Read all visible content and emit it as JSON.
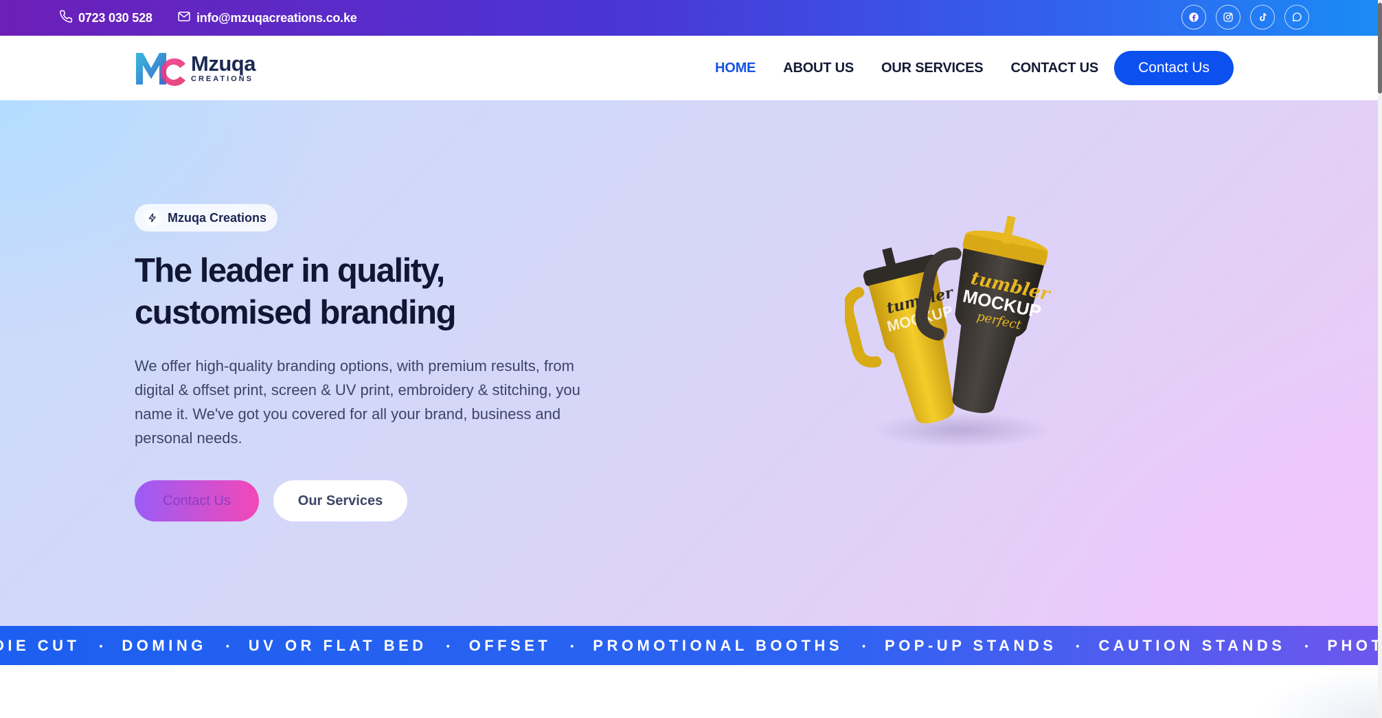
{
  "topbar": {
    "phone": "0723 030 528",
    "email": "info@mzuqacreations.co.ke",
    "socials": [
      "facebook-icon",
      "instagram-icon",
      "tiktok-icon",
      "whatsapp-icon"
    ]
  },
  "header": {
    "logo_name": "Mzuqa",
    "logo_sub": "CREATIONS",
    "nav": [
      {
        "label": "HOME",
        "active": true
      },
      {
        "label": "ABOUT US",
        "active": false
      },
      {
        "label": "OUR SERVICES",
        "active": false
      },
      {
        "label": "CONTACT US",
        "active": false
      }
    ],
    "cta_label": "Contact Us"
  },
  "hero": {
    "badge": "Mzuqa Creations",
    "title": "The leader in quality, customised branding",
    "description": "We offer high-quality branding options, with premium results, from digital & offset print, screen & UV print, embroidery & stitching, you name it. We've got you covered for all your brand, business and personal needs.",
    "primary_button": "Contact Us",
    "secondary_button": "Our Services",
    "image_text": {
      "line1": "tumbler",
      "line2": "MOCKUP",
      "line3": "perfect"
    }
  },
  "marquee": {
    "items": [
      "DIE CUT",
      "DOMING",
      "UV OR FLAT BED",
      "OFFSET",
      "PROMOTIONAL BOOTHS",
      "POP-UP STANDS",
      "CAUTION STANDS",
      "PHOTO MOU"
    ],
    "separator": "•"
  },
  "colors": {
    "accent": "#0d50f0",
    "nav_active": "#1553e6",
    "heading": "#101633",
    "marquee_bg": "#1d5ff0",
    "gradient_start": "#9a5cf6",
    "gradient_end": "#f348b8"
  }
}
